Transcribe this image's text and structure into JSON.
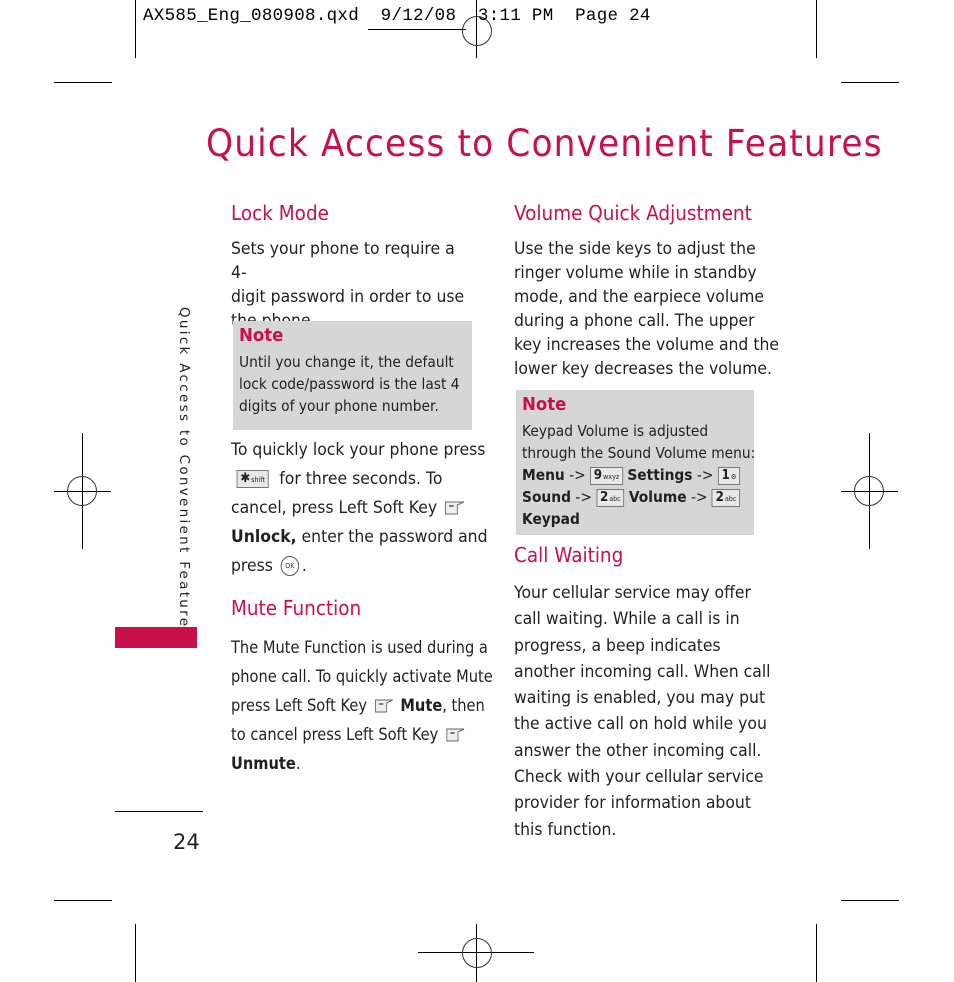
{
  "slug": {
    "file": "AX585_Eng_080908.qxd",
    "date": "9/12/08",
    "time": "3:11 PM",
    "page_label": "Page 24"
  },
  "page_title": "Quick Access to Convenient Features",
  "side_tab_label": "Quick Access to Convenient Features",
  "page_number": "24",
  "accent_color": "#c8104b",
  "note_bg_color": "#d6d6d6",
  "lock_mode": {
    "heading": "Lock Mode",
    "intro_lines": [
      "Sets your phone to require a 4-",
      "digit password in order to use",
      "the phone."
    ],
    "note": {
      "title": "Note",
      "lines": [
        "Until you change it, the default",
        "lock code/password is the last 4",
        "digits of your phone number."
      ]
    },
    "instructions": {
      "line1": "To quickly lock your phone press",
      "star_key": "✱",
      "star_key_sub": "shift",
      "line2": "for three seconds. To",
      "line3": "cancel, press Left Soft Key",
      "unlock_bold": "Unlock,",
      "line4": "enter the password and",
      "line5_pre": "press",
      "ok_key": "OK",
      "line5_post": "."
    }
  },
  "mute_function": {
    "heading": "Mute Function",
    "line1": "The Mute Function is used during a",
    "line2": "phone call. To quickly activate Mute",
    "line3_pre": "press Left Soft Key",
    "mute_bold": "Mute",
    "line3_post": ", then",
    "line4": "to cancel press Left Soft Key",
    "unmute_bold": "Unmute",
    "line5_post": "."
  },
  "volume_quick_adjustment": {
    "heading": "Volume Quick Adjustment",
    "lines": [
      "Use the side keys to adjust the",
      "ringer volume while in standby",
      "mode, and the earpiece volume",
      "during a phone call. The upper",
      "key increases the volume and the",
      "lower key decreases the volume."
    ],
    "note": {
      "title": "Note",
      "lines": [
        "Keypad Volume is adjusted",
        "through the Sound Volume menu:"
      ],
      "menu_path": {
        "menu": "Menu",
        "arrow": "->",
        "key1": "9",
        "key1_sub": "wxyz",
        "settings": "Settings",
        "key2": "1",
        "key2_sub": "⚙",
        "sound": "Sound",
        "key3": "2",
        "key3_sub": "abc",
        "volume": "Volume",
        "key4": "2",
        "key4_sub": "abc",
        "keypad": "Keypad"
      }
    }
  },
  "call_waiting": {
    "heading": "Call Waiting",
    "lines": [
      "Your cellular service may offer",
      "call waiting. While a call is in",
      "progress, a beep indicates",
      "another incoming call. When call",
      "waiting is enabled, you may put",
      "the active call on hold while you",
      "answer the other incoming call.",
      "Check with your cellular service",
      "provider for information about",
      "this function."
    ]
  }
}
